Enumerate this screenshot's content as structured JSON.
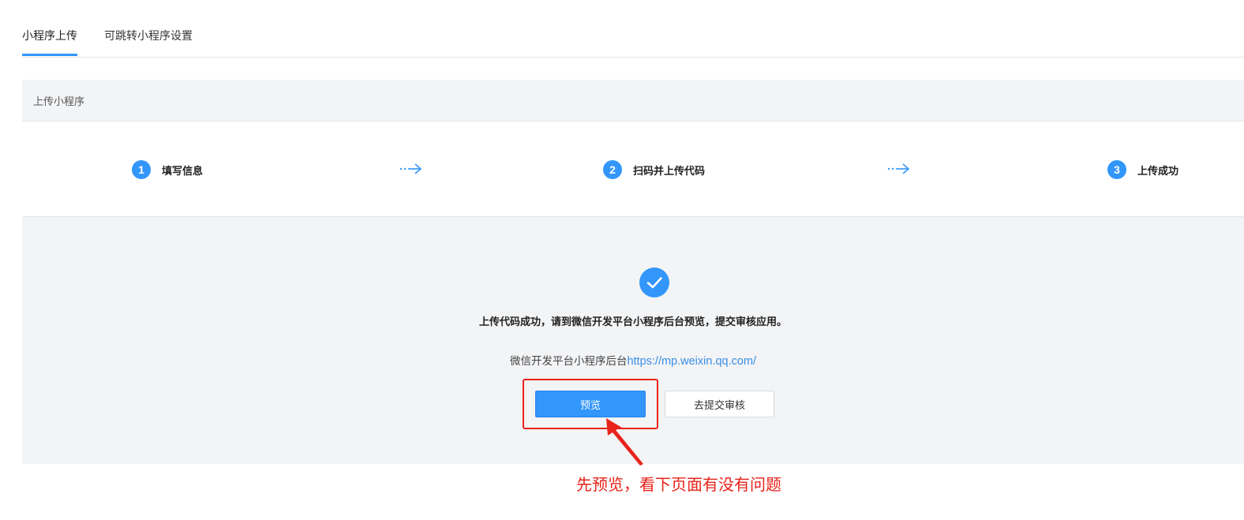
{
  "tabs": [
    {
      "label": "小程序上传",
      "active": true
    },
    {
      "label": "可跳转小程序设置",
      "active": false
    }
  ],
  "section": {
    "title": "上传小程序"
  },
  "steps": [
    {
      "number": "1",
      "label": "填写信息"
    },
    {
      "number": "2",
      "label": "扫码并上传代码"
    },
    {
      "number": "3",
      "label": "上传成功"
    }
  ],
  "result": {
    "message": "上传代码成功，请到微信开发平台小程序后台预览，提交审核应用。",
    "link_prefix": "微信开发平台小程序后台",
    "link_url": "https://mp.weixin.qq.com/",
    "preview_button": "预览",
    "submit_button": "去提交审核"
  },
  "annotation": {
    "text": "先预览，看下页面有没有问题",
    "color": "#e8231b"
  },
  "colors": {
    "accent": "#3296fa",
    "annotation": "#e8231b"
  },
  "icons": {
    "success": "check-circle-icon",
    "step_arrow": "dotted-arrow-right-icon"
  }
}
